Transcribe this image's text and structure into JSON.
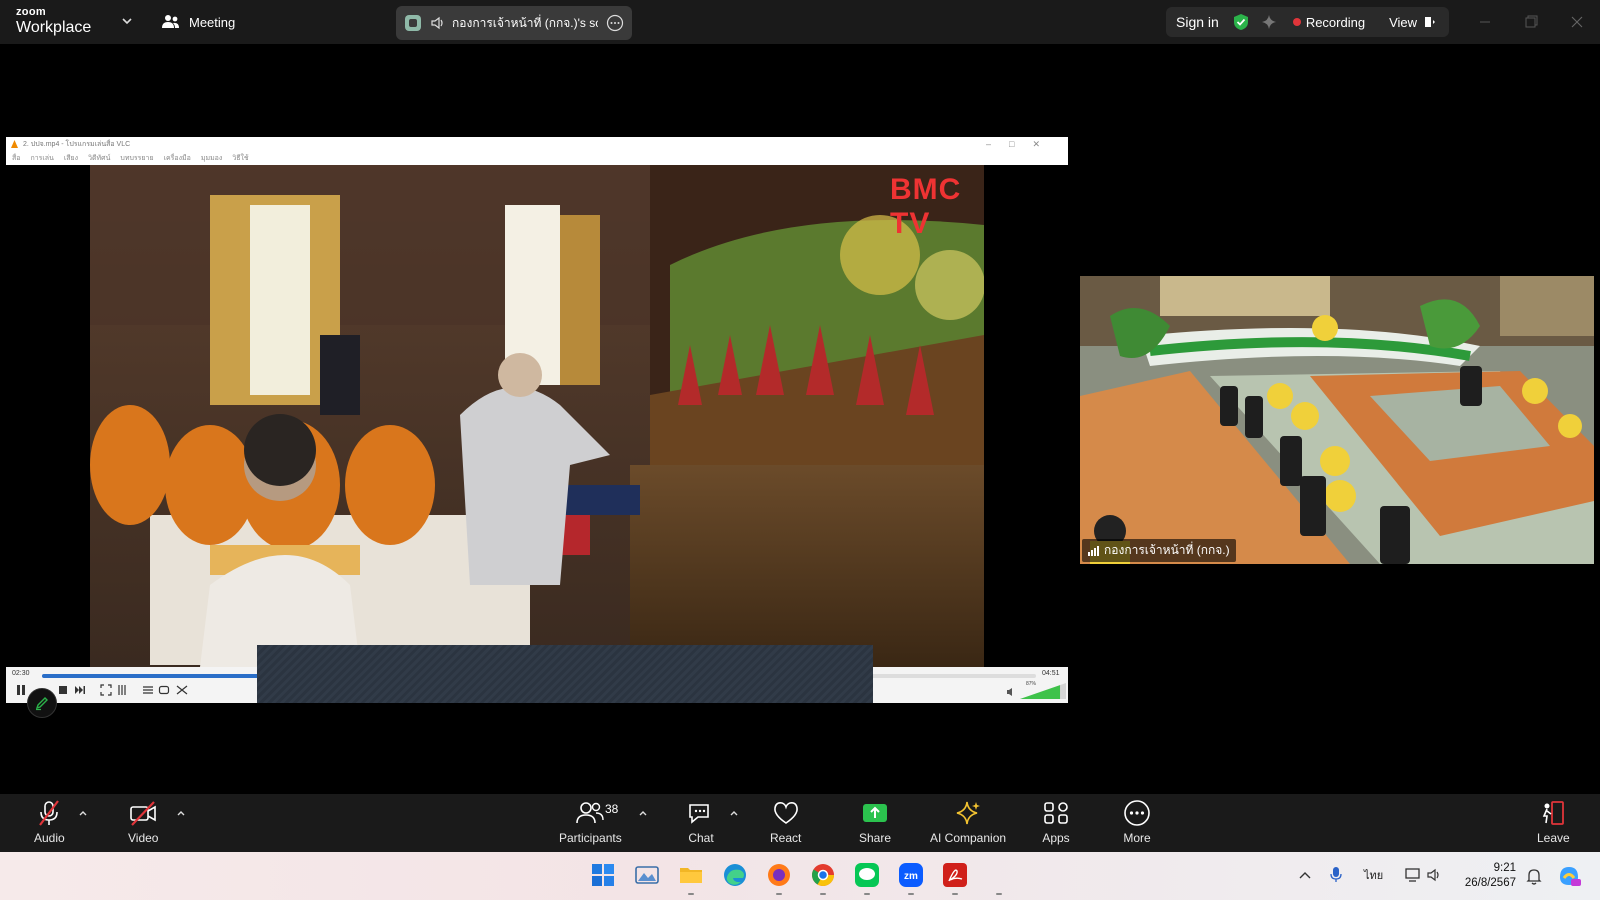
{
  "titlebar": {
    "brand_small": "zoom",
    "brand_large": "Workplace",
    "meeting_label": "Meeting",
    "share_title": "กองการเจ้าหน้าที่ (กกจ.)'s scree",
    "sign_in": "Sign in",
    "recording": "Recording",
    "view": "View",
    "accent_green": "#2bb34a",
    "record_color": "#e0353a"
  },
  "shared_window": {
    "title": "2. ปปจ.mp4 - โปรแกรมเล่นสื่อ VLC",
    "menu": [
      "สื่อ",
      "การเล่น",
      "เสียง",
      "วิดีทัศน์",
      "บทบรรยาย",
      "เครื่องมือ",
      "มุมมอง",
      "วิธีใช้"
    ],
    "watermark": "BMC TV",
    "time_elapsed": "02:30",
    "time_total": "04:51",
    "progress": 0.515,
    "volume_label": "87%",
    "volume": 0.87
  },
  "participant": {
    "name": "กองการเจ้าหน้าที่ (กกจ.)"
  },
  "toolbar": {
    "audio": "Audio",
    "video": "Video",
    "participants": "Participants",
    "participants_count": "38",
    "chat": "Chat",
    "react": "React",
    "share": "Share",
    "ai_companion": "AI Companion",
    "apps": "Apps",
    "more": "More",
    "leave": "Leave",
    "share_color": "#2bc24e",
    "ai_color": "#f2c230",
    "leave_color": "#e0353a"
  },
  "taskbar": {
    "apps": [
      "windows-start",
      "photos",
      "file-explorer",
      "edge",
      "firefox",
      "chrome",
      "line",
      "zoom",
      "acrobat"
    ],
    "language": "ไทย",
    "time": "9:21",
    "date": "26/8/2567"
  }
}
